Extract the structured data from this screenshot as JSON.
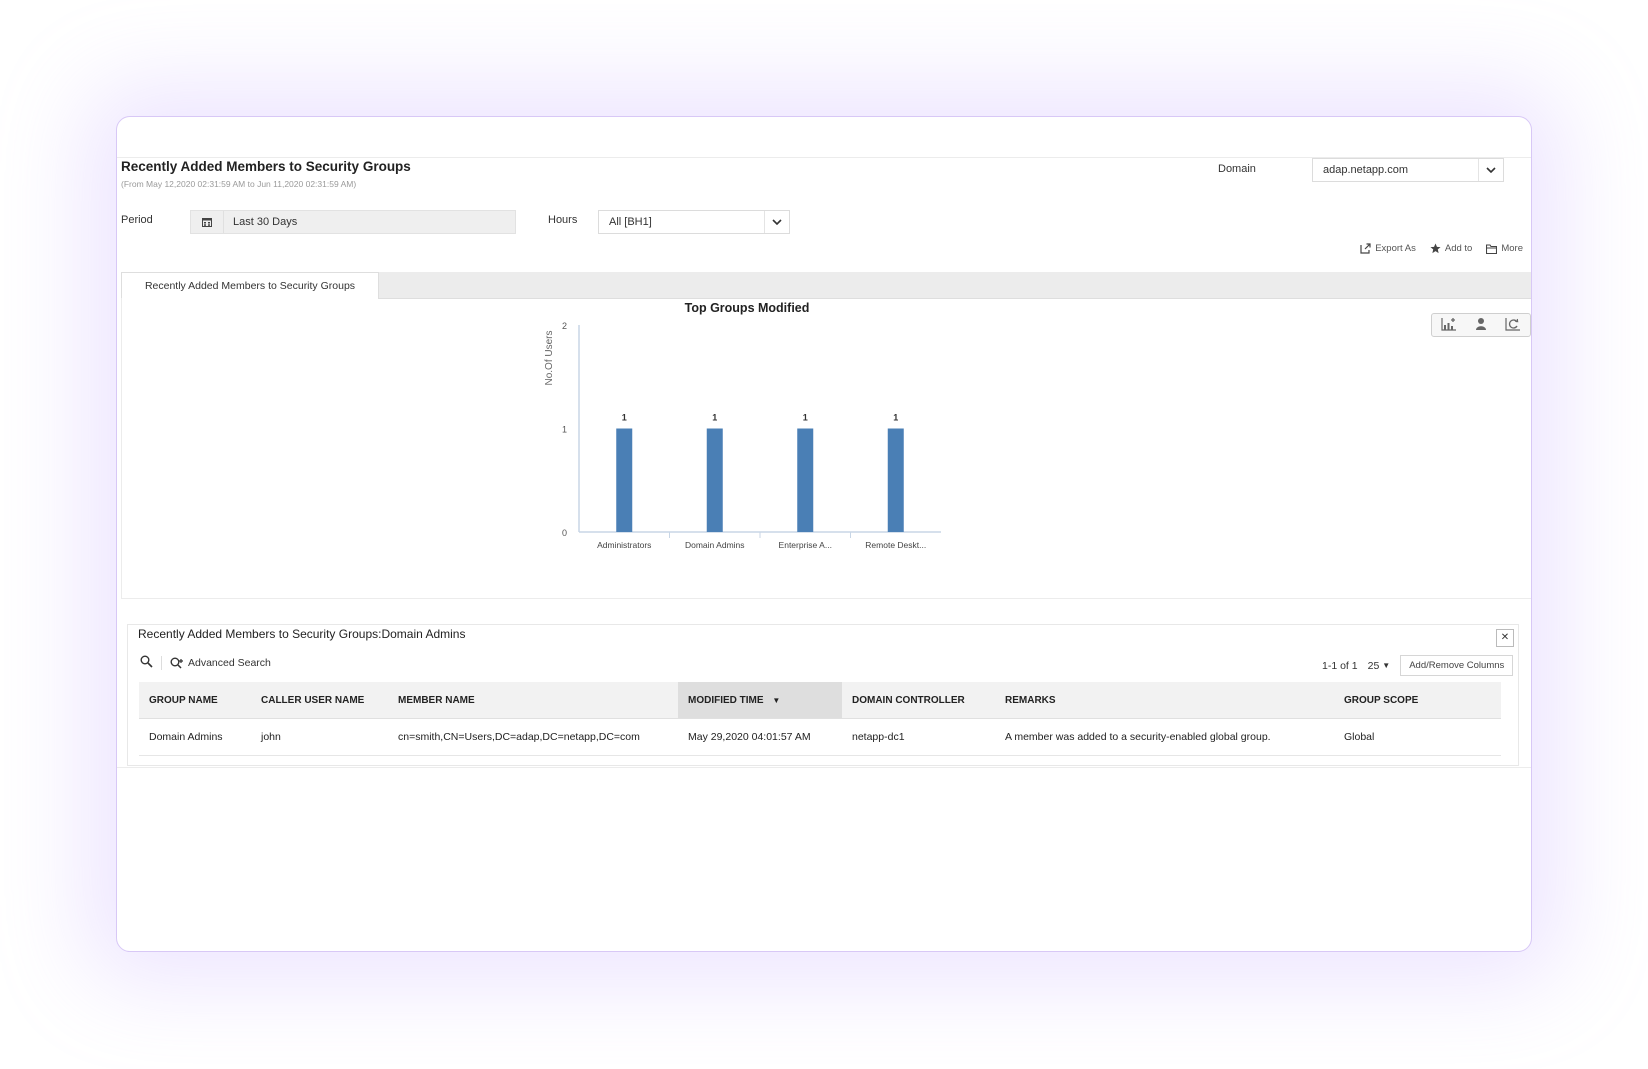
{
  "header": {
    "title": "Recently Added Members to Security Groups",
    "subtitle": "(From May 12,2020 02:31:59 AM to Jun 11,2020 02:31:59 AM)",
    "domain_label": "Domain",
    "domain_value": "adap.netapp.com"
  },
  "filters": {
    "period_label": "Period",
    "period_value": "Last 30 Days",
    "hours_label": "Hours",
    "hours_value": "All [BH1]"
  },
  "toolbar": {
    "export_label": "Export As",
    "add_label": "Add to",
    "more_label": "More"
  },
  "tabs": [
    {
      "label": "Recently Added Members to Security Groups"
    }
  ],
  "chart_data": {
    "type": "bar",
    "title": "Top Groups Modified",
    "xlabel": "",
    "ylabel": "No.Of Users",
    "categories": [
      "Administrators",
      "Domain Admins",
      "Enterprise A...",
      "Remote Deskt..."
    ],
    "values": [
      1,
      1,
      1,
      1
    ],
    "ylim": [
      0,
      2
    ],
    "yticks": [
      0,
      1,
      2
    ],
    "bar_color": "#4a7fb5",
    "grid": false
  },
  "grid": {
    "title": "Recently Added Members to Security Groups:Domain Admins",
    "advanced_search": "Advanced Search",
    "pagination": "1-1 of 1",
    "page_size": "25",
    "add_remove_columns": "Add/Remove Columns",
    "columns": [
      "GROUP NAME",
      "CALLER USER NAME",
      "MEMBER NAME",
      "MODIFIED TIME",
      "DOMAIN CONTROLLER",
      "REMARKS",
      "GROUP SCOPE"
    ],
    "rows": [
      [
        "Domain Admins",
        "john",
        "cn=smith,CN=Users,DC=adap,DC=netapp,DC=com",
        "May 29,2020 04:01:57 AM",
        "netapp-dc1",
        "A member was added to a security-enabled global group.",
        "Global"
      ]
    ]
  }
}
